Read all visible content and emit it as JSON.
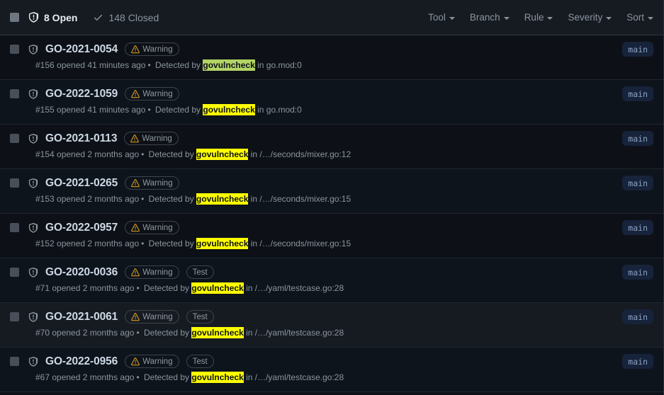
{
  "header": {
    "select_all_checkbox": "unchecked",
    "states": [
      {
        "id": "open",
        "icon": "shield-alert-icon",
        "label": "8 Open"
      },
      {
        "id": "closed",
        "icon": "check-icon",
        "label": "148 Closed"
      }
    ],
    "filters": [
      {
        "id": "tool",
        "label": "Tool"
      },
      {
        "id": "branch",
        "label": "Branch"
      },
      {
        "id": "rule",
        "label": "Rule"
      },
      {
        "id": "severity",
        "label": "Severity"
      },
      {
        "id": "sort",
        "label": "Sort"
      }
    ]
  },
  "search_highlight_term": "govulncheck",
  "alerts": [
    {
      "title": "GO-2021-0054",
      "badges": [
        {
          "label": "Warning",
          "icon": "warning-triangle-icon"
        }
      ],
      "number": "#156",
      "opened": "opened 41 minutes ago",
      "detected_by_prefix": "Detected by",
      "tool": "govulncheck",
      "highlight": "current",
      "location_prefix": "in",
      "location": "go.mod:0",
      "branch": "main"
    },
    {
      "title": "GO-2022-1059",
      "badges": [
        {
          "label": "Warning",
          "icon": "warning-triangle-icon"
        }
      ],
      "number": "#155",
      "opened": "opened 41 minutes ago",
      "detected_by_prefix": "Detected by",
      "tool": "govulncheck",
      "highlight": "match",
      "location_prefix": "in",
      "location": "go.mod:0",
      "branch": "main"
    },
    {
      "title": "GO-2021-0113",
      "badges": [
        {
          "label": "Warning",
          "icon": "warning-triangle-icon"
        }
      ],
      "number": "#154",
      "opened": "opened 2 months ago",
      "detected_by_prefix": "Detected by",
      "tool": "govulncheck",
      "highlight": "match",
      "location_prefix": "in",
      "location": "/…/seconds/mixer.go:12",
      "branch": "main"
    },
    {
      "title": "GO-2021-0265",
      "badges": [
        {
          "label": "Warning",
          "icon": "warning-triangle-icon"
        }
      ],
      "number": "#153",
      "opened": "opened 2 months ago",
      "detected_by_prefix": "Detected by",
      "tool": "govulncheck",
      "highlight": "match",
      "location_prefix": "in",
      "location": "/…/seconds/mixer.go:15",
      "branch": "main"
    },
    {
      "title": "GO-2022-0957",
      "badges": [
        {
          "label": "Warning",
          "icon": "warning-triangle-icon"
        }
      ],
      "number": "#152",
      "opened": "opened 2 months ago",
      "detected_by_prefix": "Detected by",
      "tool": "govulncheck",
      "highlight": "match",
      "location_prefix": "in",
      "location": "/…/seconds/mixer.go:15",
      "branch": "main"
    },
    {
      "title": "GO-2020-0036",
      "badges": [
        {
          "label": "Warning",
          "icon": "warning-triangle-icon"
        },
        {
          "label": "Test",
          "icon": "none"
        }
      ],
      "number": "#71",
      "opened": "opened 2 months ago",
      "detected_by_prefix": "Detected by",
      "tool": "govulncheck",
      "highlight": "match",
      "location_prefix": "in",
      "location": "/…/yaml/testcase.go:28",
      "branch": "main"
    },
    {
      "title": "GO-2021-0061",
      "badges": [
        {
          "label": "Warning",
          "icon": "warning-triangle-icon"
        },
        {
          "label": "Test",
          "icon": "none"
        }
      ],
      "number": "#70",
      "opened": "opened 2 months ago",
      "detected_by_prefix": "Detected by",
      "tool": "govulncheck",
      "highlight": "match",
      "location_prefix": "in",
      "location": "/…/yaml/testcase.go:28",
      "branch": "main"
    },
    {
      "title": "GO-2022-0956",
      "badges": [
        {
          "label": "Warning",
          "icon": "warning-triangle-icon"
        },
        {
          "label": "Test",
          "icon": "none"
        }
      ],
      "number": "#67",
      "opened": "opened 2 months ago",
      "detected_by_prefix": "Detected by",
      "tool": "govulncheck",
      "highlight": "match",
      "location_prefix": "in",
      "location": "/…/yaml/testcase.go:28",
      "branch": "main"
    }
  ],
  "colors": {
    "background": "#0d1117",
    "header_background": "#161b22",
    "border": "#21262d",
    "link": "#cdd9e5",
    "muted_text": "#8b949e",
    "warning_icon": "#d29922",
    "highlight_match": "#ffff00",
    "highlight_current": "#b3d465",
    "branch_badge_bg": "#17233a",
    "branch_badge_text": "#8ba3c7"
  }
}
